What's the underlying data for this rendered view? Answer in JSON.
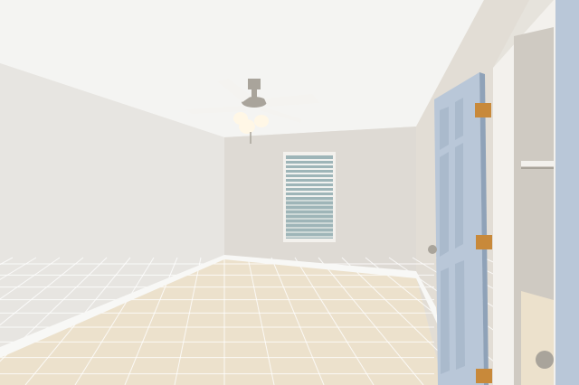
{
  "scene": {
    "colors": {
      "ceiling": "#f4f4f2",
      "left_wall": "#e7e5e1",
      "back_wall": "#dedad4",
      "right_wall": "#e2ddd5",
      "floor": "#ece1cc",
      "grout": "#ffffff",
      "baseboard": "#f8f8f6",
      "door": "#b9c7d8",
      "door_shadow": "#8fa2b8",
      "hinge": "#c8893a",
      "trim": "#f3f1ed",
      "closet": "#cfcac2",
      "fan_body": "#a9a49b",
      "fan_blade": "#f4f3f0",
      "globe": "#fff7e6",
      "window_glass": "#9eb5b8",
      "window_blind": "#f5f5f2"
    },
    "objects": [
      "ceiling-fan",
      "window-with-blinds",
      "interior-door",
      "closet",
      "tile-floor",
      "baseboard",
      "hinges"
    ]
  }
}
